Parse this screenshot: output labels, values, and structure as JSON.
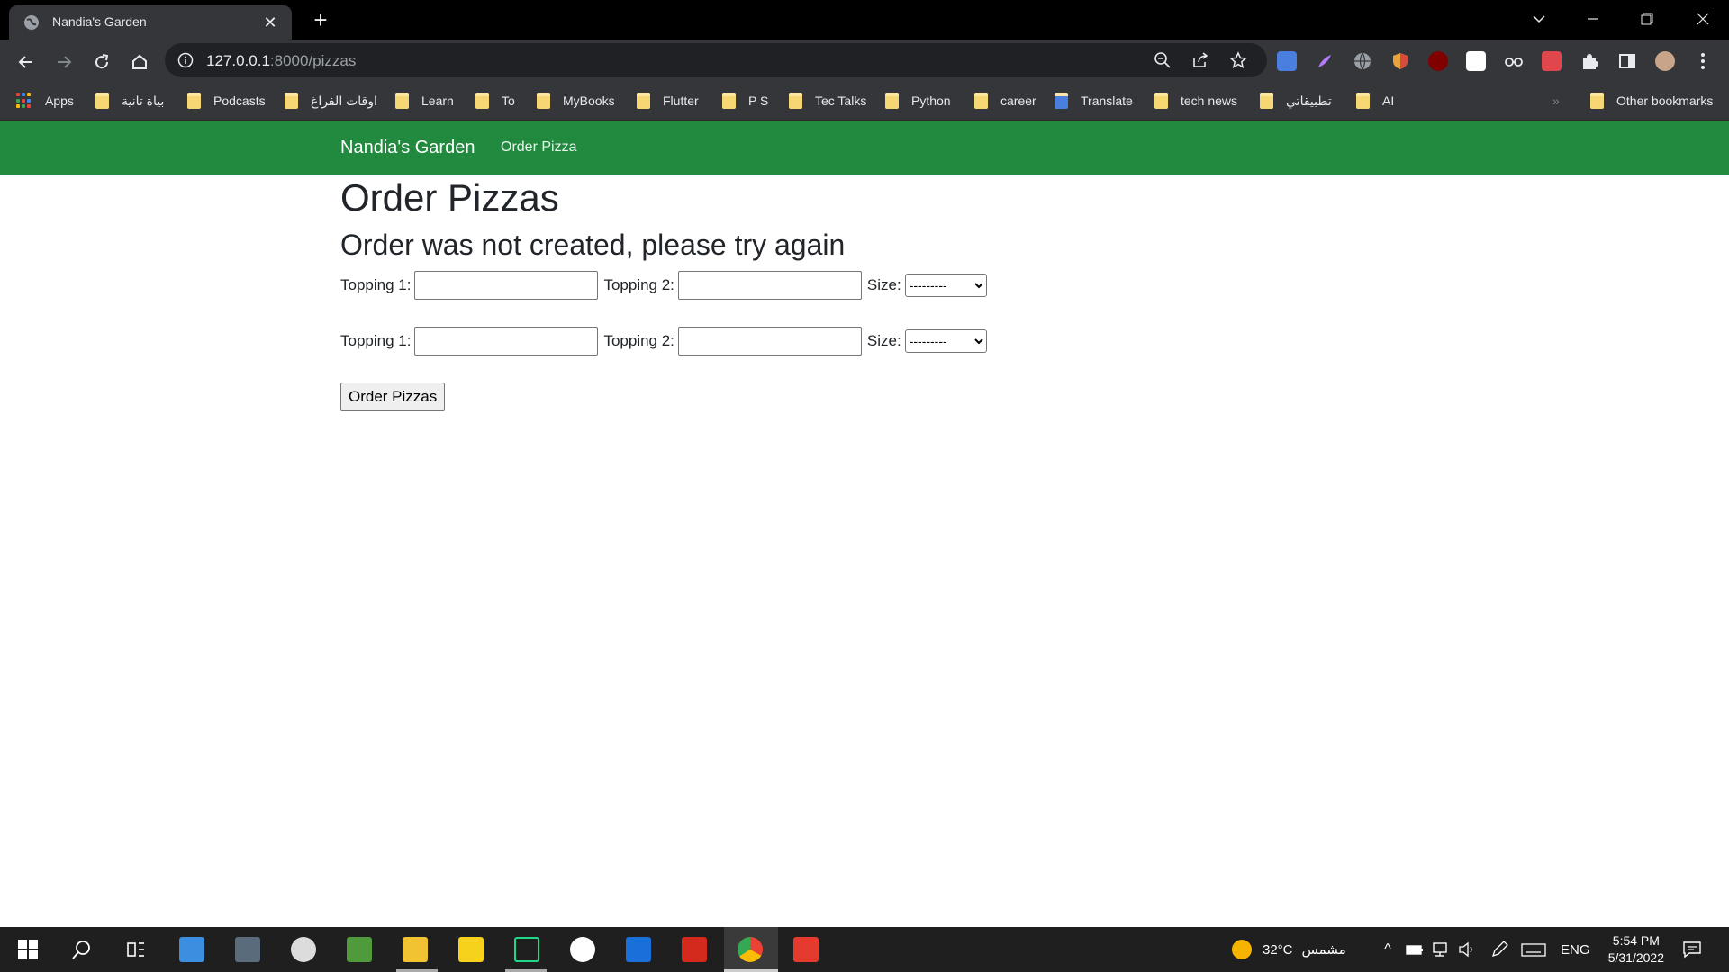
{
  "browser": {
    "tab_title": "Nandia's Garden",
    "url_host": "127.0.0.1",
    "url_rest": ":8000/pizzas"
  },
  "bookmarks": [
    {
      "label": "Apps",
      "type": "apps"
    },
    {
      "label": "بياة تانية",
      "type": "folder"
    },
    {
      "label": "Podcasts",
      "type": "folder"
    },
    {
      "label": "اوقات الفراغ",
      "type": "folder"
    },
    {
      "label": "Learn",
      "type": "folder"
    },
    {
      "label": "To",
      "type": "folder"
    },
    {
      "label": "MyBooks",
      "type": "folder"
    },
    {
      "label": "Flutter",
      "type": "folder"
    },
    {
      "label": "P S",
      "type": "folder"
    },
    {
      "label": "Tec Talks",
      "type": "folder"
    },
    {
      "label": "Python",
      "type": "folder"
    },
    {
      "label": "career",
      "type": "folder"
    },
    {
      "label": "Translate",
      "type": "translate"
    },
    {
      "label": "tech news",
      "type": "folder"
    },
    {
      "label": "تطبيقاتي",
      "type": "folder"
    },
    {
      "label": "AI",
      "type": "folder"
    },
    {
      "label": "Other bookmarks",
      "type": "folder"
    }
  ],
  "site": {
    "brand": "Nandia's Garden",
    "nav_link": "Order Pizza"
  },
  "main": {
    "heading": "Order Pizzas",
    "error_message": "Order was not created, please try again",
    "forms": [
      {
        "topping1_label": "Topping 1:",
        "topping1_value": "",
        "topping2_label": "Topping 2:",
        "topping2_value": "",
        "size_label": "Size:",
        "size_selected": "---------"
      },
      {
        "topping1_label": "Topping 1:",
        "topping1_value": "",
        "topping2_label": "Topping 2:",
        "topping2_value": "",
        "size_label": "Size:",
        "size_selected": "---------"
      }
    ],
    "submit_label": "Order Pizzas"
  },
  "taskbar": {
    "weather_temp": "32°C",
    "weather_text": "مشمس",
    "language": "ENG",
    "time": "5:54 PM",
    "date": "5/31/2022"
  },
  "colors": {
    "navbar": "#218a3f",
    "chrome_dark": "#35363a"
  }
}
